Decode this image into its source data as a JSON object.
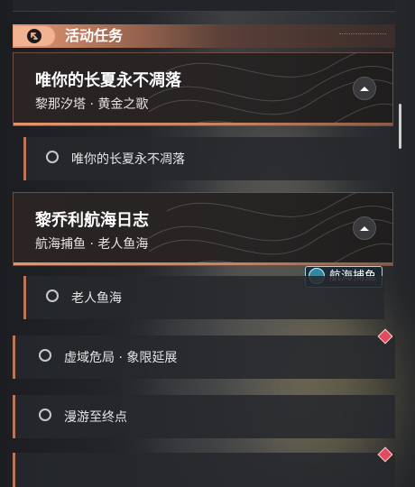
{
  "section": {
    "title": "活动任务",
    "icon": "return-arrow-icon"
  },
  "missions": [
    {
      "title": "唯你的长夏永不凋落",
      "subtitle": "黎那汐塔 · 黄金之歌",
      "collapse_icon": "chevron-up-icon",
      "tasks": [
        "唯你的长夏永不凋落"
      ]
    },
    {
      "title": "黎乔利航海日志",
      "subtitle": "航海捕鱼 · 老人鱼海",
      "collapse_icon": "chevron-up-icon",
      "tasks": [
        "老人鱼海"
      ]
    }
  ],
  "badge": {
    "label": "航海捕鱼",
    "icon": "fishing-hook-icon"
  },
  "standalone_tasks": [
    {
      "label": "虚域危局 · 象限延展",
      "marker": "red-diamond"
    },
    {
      "label": "漫游至终点",
      "marker": ""
    }
  ],
  "colors": {
    "accent": "#e99c79",
    "marker": "#e24a5e",
    "badge_border": "#9fd8e8"
  }
}
